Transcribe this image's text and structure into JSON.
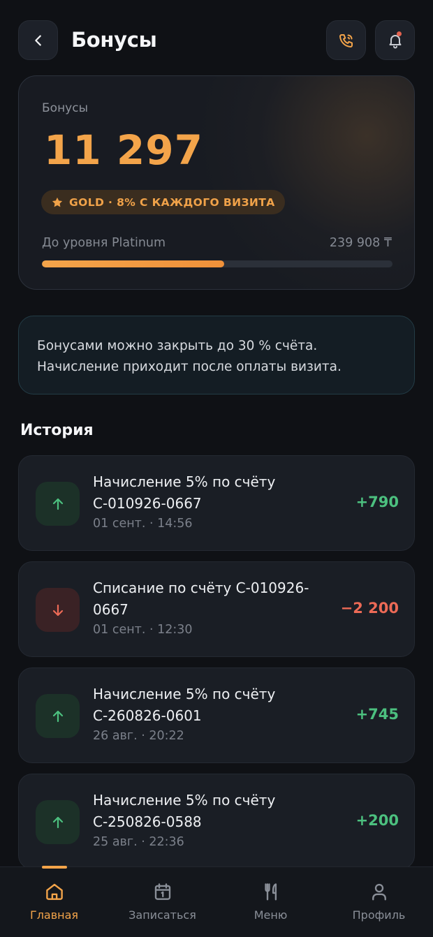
{
  "header": {
    "title": "Бонусы",
    "icons": {
      "back": "chevron-left-icon",
      "phone": "phone-icon",
      "bell": "bell-icon"
    },
    "notification_dot": true
  },
  "bonus_card": {
    "label": "Бонусы",
    "value": "11 297",
    "tier_badge": "GOLD · 8% С КАЖДОГО ВИЗИТА",
    "progress_label": "До уровня Platinum",
    "progress_amount": "239 908 ₸",
    "progress_fraction": 0.52
  },
  "info": {
    "line1": "Бонусами можно закрыть до 30 % счёта.",
    "line2": "Начисление приходит после оплаты визита."
  },
  "history": {
    "title": "История",
    "items": [
      {
        "direction": "up",
        "title": "Начисление 5% по счёту С-010926-0667",
        "date": "01 сент. · 14:56",
        "amount": "+790"
      },
      {
        "direction": "down",
        "title": "Списание по счёту С-010926-0667",
        "date": "01 сент. · 12:30",
        "amount": "−2 200"
      },
      {
        "direction": "up",
        "title": "Начисление 5% по счёту С-260826-0601",
        "date": "26 авг. · 20:22",
        "amount": "+745"
      },
      {
        "direction": "up",
        "title": "Начисление 5% по счёту С-250826-0588",
        "date": "25 авг. · 22:36",
        "amount": "+200"
      }
    ]
  },
  "nav": {
    "items": [
      {
        "label": "Главная",
        "icon": "home-icon",
        "active": true
      },
      {
        "label": "Записаться",
        "icon": "calendar-icon",
        "active": false
      },
      {
        "label": "Меню",
        "icon": "fork-knife-icon",
        "active": false
      },
      {
        "label": "Профиль",
        "icon": "user-icon",
        "active": false
      }
    ]
  },
  "colors": {
    "accent": "#f3a44a",
    "positive": "#4cc07f",
    "negative": "#ec6a56",
    "background": "#0f1115",
    "card": "#1a1e25"
  }
}
